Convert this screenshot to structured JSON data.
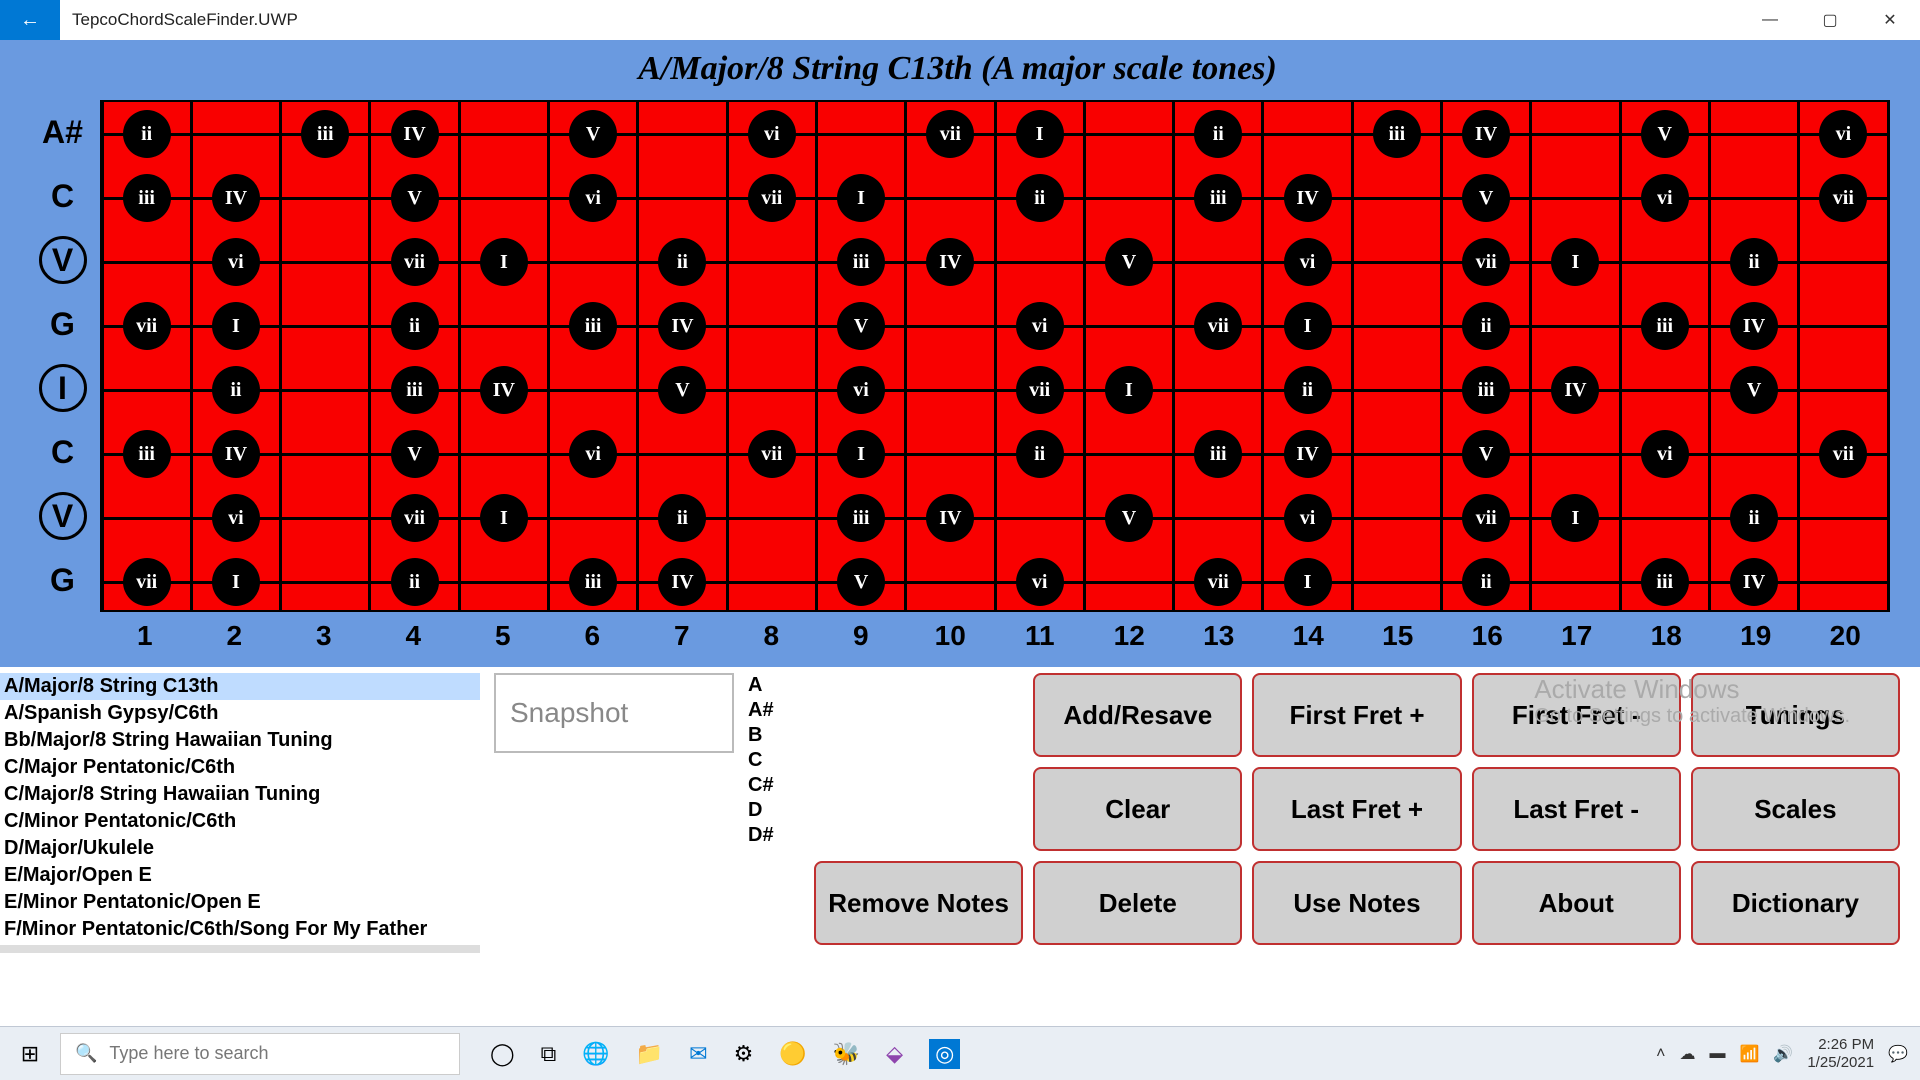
{
  "window": {
    "app_name": "TepcoChordScaleFinder.UWP",
    "back_icon": "←",
    "min_icon": "—",
    "max_icon": "▢",
    "close_icon": "✕"
  },
  "heading": "A/Major/8 String C13th (A major scale tones)",
  "strings": [
    {
      "label": "A#",
      "circled": false
    },
    {
      "label": "C",
      "circled": false
    },
    {
      "label": "V",
      "circled": true
    },
    {
      "label": "G",
      "circled": false
    },
    {
      "label": "I",
      "circled": true
    },
    {
      "label": "C",
      "circled": false
    },
    {
      "label": "V",
      "circled": true
    },
    {
      "label": "G",
      "circled": false
    }
  ],
  "fret_numbers": [
    "1",
    "2",
    "3",
    "4",
    "5",
    "6",
    "7",
    "8",
    "9",
    "10",
    "11",
    "12",
    "13",
    "14",
    "15",
    "16",
    "17",
    "18",
    "19",
    "20"
  ],
  "fretboard": {
    "rows": [
      [
        {
          "f": 1,
          "t": "ii"
        },
        {
          "f": 3,
          "t": "iii"
        },
        {
          "f": 4,
          "t": "IV"
        },
        {
          "f": 6,
          "t": "V"
        },
        {
          "f": 8,
          "t": "vi"
        },
        {
          "f": 10,
          "t": "vii"
        },
        {
          "f": 11,
          "t": "I"
        },
        {
          "f": 13,
          "t": "ii"
        },
        {
          "f": 15,
          "t": "iii"
        },
        {
          "f": 16,
          "t": "IV"
        },
        {
          "f": 18,
          "t": "V"
        },
        {
          "f": 20,
          "t": "vi"
        }
      ],
      [
        {
          "f": 1,
          "t": "iii"
        },
        {
          "f": 2,
          "t": "IV"
        },
        {
          "f": 4,
          "t": "V"
        },
        {
          "f": 6,
          "t": "vi"
        },
        {
          "f": 8,
          "t": "vii"
        },
        {
          "f": 9,
          "t": "I"
        },
        {
          "f": 11,
          "t": "ii"
        },
        {
          "f": 13,
          "t": "iii"
        },
        {
          "f": 14,
          "t": "IV"
        },
        {
          "f": 16,
          "t": "V"
        },
        {
          "f": 18,
          "t": "vi"
        },
        {
          "f": 20,
          "t": "vii"
        }
      ],
      [
        {
          "f": 2,
          "t": "vi"
        },
        {
          "f": 4,
          "t": "vii"
        },
        {
          "f": 5,
          "t": "I"
        },
        {
          "f": 7,
          "t": "ii"
        },
        {
          "f": 9,
          "t": "iii"
        },
        {
          "f": 10,
          "t": "IV"
        },
        {
          "f": 12,
          "t": "V"
        },
        {
          "f": 14,
          "t": "vi"
        },
        {
          "f": 16,
          "t": "vii"
        },
        {
          "f": 17,
          "t": "I"
        },
        {
          "f": 19,
          "t": "ii"
        }
      ],
      [
        {
          "f": 1,
          "t": "vii"
        },
        {
          "f": 2,
          "t": "I"
        },
        {
          "f": 4,
          "t": "ii"
        },
        {
          "f": 6,
          "t": "iii"
        },
        {
          "f": 7,
          "t": "IV"
        },
        {
          "f": 9,
          "t": "V"
        },
        {
          "f": 11,
          "t": "vi"
        },
        {
          "f": 13,
          "t": "vii"
        },
        {
          "f": 14,
          "t": "I"
        },
        {
          "f": 16,
          "t": "ii"
        },
        {
          "f": 18,
          "t": "iii"
        },
        {
          "f": 19,
          "t": "IV"
        }
      ],
      [
        {
          "f": 2,
          "t": "ii"
        },
        {
          "f": 4,
          "t": "iii"
        },
        {
          "f": 5,
          "t": "IV"
        },
        {
          "f": 7,
          "t": "V"
        },
        {
          "f": 9,
          "t": "vi"
        },
        {
          "f": 11,
          "t": "vii"
        },
        {
          "f": 12,
          "t": "I"
        },
        {
          "f": 14,
          "t": "ii"
        },
        {
          "f": 16,
          "t": "iii"
        },
        {
          "f": 17,
          "t": "IV"
        },
        {
          "f": 19,
          "t": "V"
        }
      ],
      [
        {
          "f": 1,
          "t": "iii"
        },
        {
          "f": 2,
          "t": "IV"
        },
        {
          "f": 4,
          "t": "V"
        },
        {
          "f": 6,
          "t": "vi"
        },
        {
          "f": 8,
          "t": "vii"
        },
        {
          "f": 9,
          "t": "I"
        },
        {
          "f": 11,
          "t": "ii"
        },
        {
          "f": 13,
          "t": "iii"
        },
        {
          "f": 14,
          "t": "IV"
        },
        {
          "f": 16,
          "t": "V"
        },
        {
          "f": 18,
          "t": "vi"
        },
        {
          "f": 20,
          "t": "vii"
        }
      ],
      [
        {
          "f": 2,
          "t": "vi"
        },
        {
          "f": 4,
          "t": "vii"
        },
        {
          "f": 5,
          "t": "I"
        },
        {
          "f": 7,
          "t": "ii"
        },
        {
          "f": 9,
          "t": "iii"
        },
        {
          "f": 10,
          "t": "IV"
        },
        {
          "f": 12,
          "t": "V"
        },
        {
          "f": 14,
          "t": "vi"
        },
        {
          "f": 16,
          "t": "vii"
        },
        {
          "f": 17,
          "t": "I"
        },
        {
          "f": 19,
          "t": "ii"
        }
      ],
      [
        {
          "f": 1,
          "t": "vii"
        },
        {
          "f": 2,
          "t": "I"
        },
        {
          "f": 4,
          "t": "ii"
        },
        {
          "f": 6,
          "t": "iii"
        },
        {
          "f": 7,
          "t": "IV"
        },
        {
          "f": 9,
          "t": "V"
        },
        {
          "f": 11,
          "t": "vi"
        },
        {
          "f": 13,
          "t": "vii"
        },
        {
          "f": 14,
          "t": "I"
        },
        {
          "f": 16,
          "t": "ii"
        },
        {
          "f": 18,
          "t": "iii"
        },
        {
          "f": 19,
          "t": "IV"
        }
      ]
    ]
  },
  "presets": [
    {
      "label": "A/Major/8 String C13th",
      "selected": true
    },
    {
      "label": "A/Spanish Gypsy/C6th",
      "selected": false
    },
    {
      "label": "Bb/Major/8 String Hawaiian Tuning",
      "selected": false
    },
    {
      "label": "C/Major Pentatonic/C6th",
      "selected": false
    },
    {
      "label": "C/Major/8 String Hawaiian Tuning",
      "selected": false
    },
    {
      "label": "C/Minor Pentatonic/C6th",
      "selected": false
    },
    {
      "label": "D/Major/Ukulele",
      "selected": false
    },
    {
      "label": "E/Major/Open E",
      "selected": false
    },
    {
      "label": "E/Minor Pentatonic/Open E",
      "selected": false
    },
    {
      "label": "F/Minor Pentatonic/C6th/Song For My Father",
      "selected": false
    }
  ],
  "snapshot_label": "Snapshot",
  "note_column": [
    "A",
    "A#",
    "B",
    "C",
    "C#",
    "D",
    "D#"
  ],
  "buttons": {
    "add_resave": "Add/Resave",
    "first_fret_plus": "First Fret +",
    "first_fret_minus": "First Fret -",
    "tunings": "Tunings",
    "clear": "Clear",
    "last_fret_plus": "Last Fret +",
    "last_fret_minus": "Last Fret -",
    "scales": "Scales",
    "remove_notes": "Remove Notes",
    "delete": "Delete",
    "use_notes": "Use Notes",
    "about": "About",
    "dictionary": "Dictionary"
  },
  "watermark": {
    "title": "Activate Windows",
    "sub": "Go to Settings to activate Windows."
  },
  "taskbar": {
    "search_placeholder": "Type here to search",
    "time": "2:26 PM",
    "date": "1/25/2021"
  }
}
